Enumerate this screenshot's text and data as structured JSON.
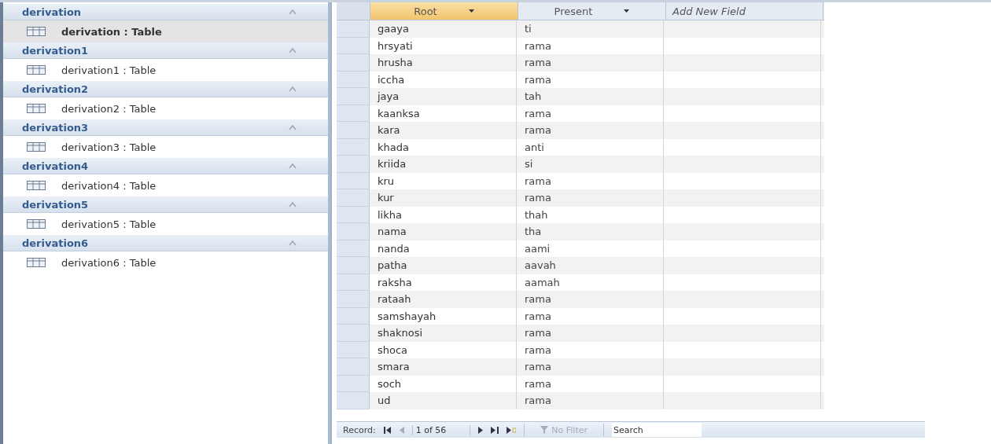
{
  "navigation_pane": {
    "groups": [
      {
        "title": "derivation",
        "items": [
          {
            "label": "derivation : Table",
            "selected": true
          }
        ]
      },
      {
        "title": "derivation1",
        "items": [
          {
            "label": "derivation1 : Table",
            "selected": false
          }
        ]
      },
      {
        "title": "derivation2",
        "items": [
          {
            "label": "derivation2 : Table",
            "selected": false
          }
        ]
      },
      {
        "title": "derivation3",
        "items": [
          {
            "label": "derivation3 : Table",
            "selected": false
          }
        ]
      },
      {
        "title": "derivation4",
        "items": [
          {
            "label": "derivation4 : Table",
            "selected": false
          }
        ]
      },
      {
        "title": "derivation5",
        "items": [
          {
            "label": "derivation5 : Table",
            "selected": false
          }
        ]
      },
      {
        "title": "derivation6",
        "items": [
          {
            "label": "derivation6 : Table",
            "selected": false
          }
        ]
      }
    ]
  },
  "datasheet": {
    "columns": [
      {
        "label": "Root",
        "selected": true,
        "kind": "field"
      },
      {
        "label": "Present",
        "selected": false,
        "kind": "field"
      },
      {
        "label": "Add New Field",
        "selected": false,
        "kind": "new"
      }
    ],
    "rows": [
      [
        "gaaya",
        "ti"
      ],
      [
        "hrsyati",
        "rama"
      ],
      [
        "hrusha",
        "rama"
      ],
      [
        "iccha",
        "rama"
      ],
      [
        "jaya",
        "tah"
      ],
      [
        "kaanksa",
        "rama"
      ],
      [
        "kara",
        "rama"
      ],
      [
        "khada",
        "anti"
      ],
      [
        "kriida",
        "si"
      ],
      [
        "kru",
        "rama"
      ],
      [
        "kur",
        "rama"
      ],
      [
        "likha",
        "thah"
      ],
      [
        "nama",
        "tha"
      ],
      [
        "nanda",
        "aami"
      ],
      [
        "patha",
        "aavah"
      ],
      [
        "raksha",
        "aamah"
      ],
      [
        "rataah",
        "rama"
      ],
      [
        "samshayah",
        "rama"
      ],
      [
        "shaknosi",
        "rama"
      ],
      [
        "shoca",
        "rama"
      ],
      [
        "smara",
        "rama"
      ],
      [
        "soch",
        "rama"
      ],
      [
        "ud",
        "rama"
      ]
    ]
  },
  "record_navigator": {
    "label": "Record:",
    "position": "1 of 56",
    "filter": "No Filter",
    "search_placeholder": "Search"
  }
}
